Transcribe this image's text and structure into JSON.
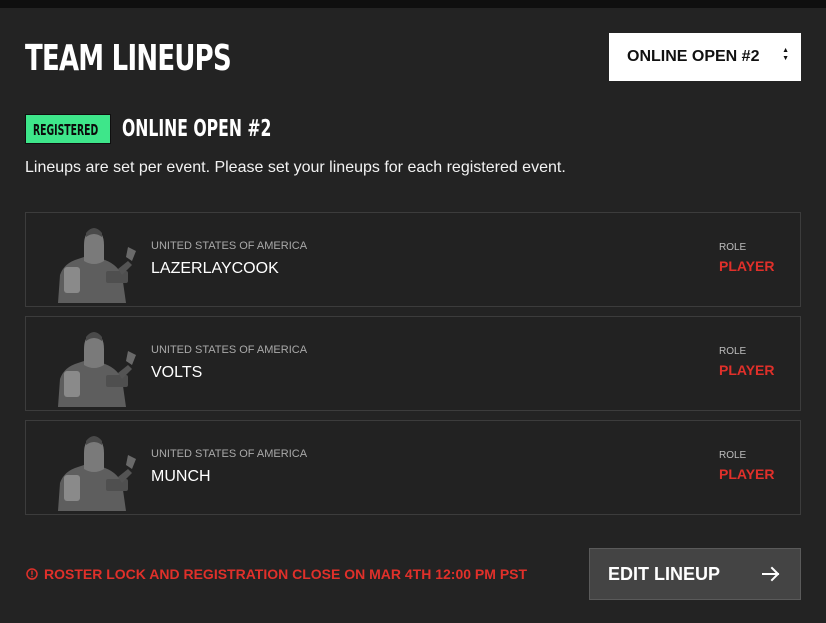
{
  "header": {
    "title": "TEAM LINEUPS",
    "event_select": {
      "selected": "ONLINE OPEN #2",
      "icon": "chevron-updown-icon"
    }
  },
  "event": {
    "status_badge": "REGISTERED",
    "name": "ONLINE OPEN #2",
    "description": "Lineups are set per event. Please set your lineups for each registered event."
  },
  "lineup": {
    "players": [
      {
        "country": "UNITED STATES OF AMERICA",
        "name": "LAZERLAYCOOK",
        "role_label": "ROLE",
        "role": "PLAYER"
      },
      {
        "country": "UNITED STATES OF AMERICA",
        "name": "VOLTS",
        "role_label": "ROLE",
        "role": "PLAYER"
      },
      {
        "country": "UNITED STATES OF AMERICA",
        "name": "MUNCH",
        "role_label": "ROLE",
        "role": "PLAYER"
      }
    ]
  },
  "footer": {
    "notice": "ROSTER LOCK AND REGISTRATION CLOSE ON MAR 4TH 12:00 PM PST",
    "notice_icon": "alert-circle-icon",
    "edit_button_label": "EDIT LINEUP",
    "edit_button_icon": "arrow-right-icon"
  },
  "colors": {
    "background": "#232323",
    "badge": "#3ee68a",
    "accent_red": "#e0302a",
    "button": "#444444"
  }
}
